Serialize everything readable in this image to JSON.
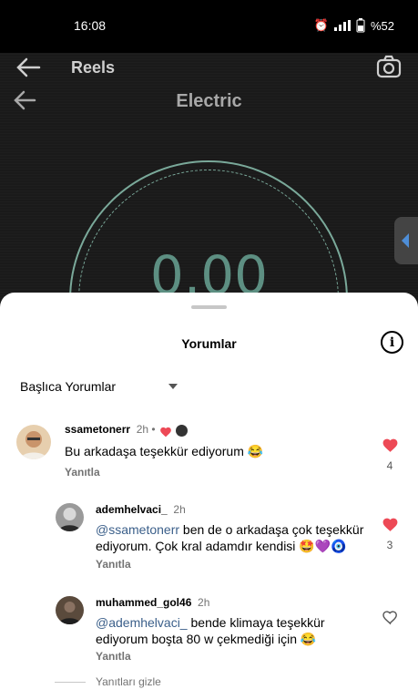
{
  "status_bar": {
    "time": "16:08",
    "battery": "%52"
  },
  "video": {
    "header_title": "Reels",
    "inner_title": "Electric",
    "reading": "0.00"
  },
  "sheet": {
    "title": "Yorumlar",
    "info_glyph": "i",
    "sort_label": "Başlıca Yorumlar",
    "comments": [
      {
        "username": "ssametonerr",
        "time": "2h",
        "separator": "•",
        "text": "Bu arkadaşa teşekkür ediyorum 😂",
        "reply_label": "Yanıtla",
        "likes": "4"
      },
      {
        "username": "ademhelvaci_",
        "time": "2h",
        "mention": "@ssametonerr",
        "text": " ben de o arkadaşa çok teşekkür ediyorum. Çok kral adamdır kendisi 🤩💜🧿",
        "reply_label": "Yanıtla",
        "likes": "3"
      },
      {
        "username": "muhammed_gol46",
        "time": "2h",
        "mention": "@ademhelvaci_",
        "text": " bende klimaya teşekkür ediyorum boşta 80 w çekmediği için 😂",
        "reply_label": "Yanıtla"
      }
    ],
    "hide_replies": "Yanıtları gizle"
  },
  "colors": {
    "like_red": "#ed4956",
    "mention_blue": "#3b5f8a",
    "dial_green": "#7aa99a"
  }
}
